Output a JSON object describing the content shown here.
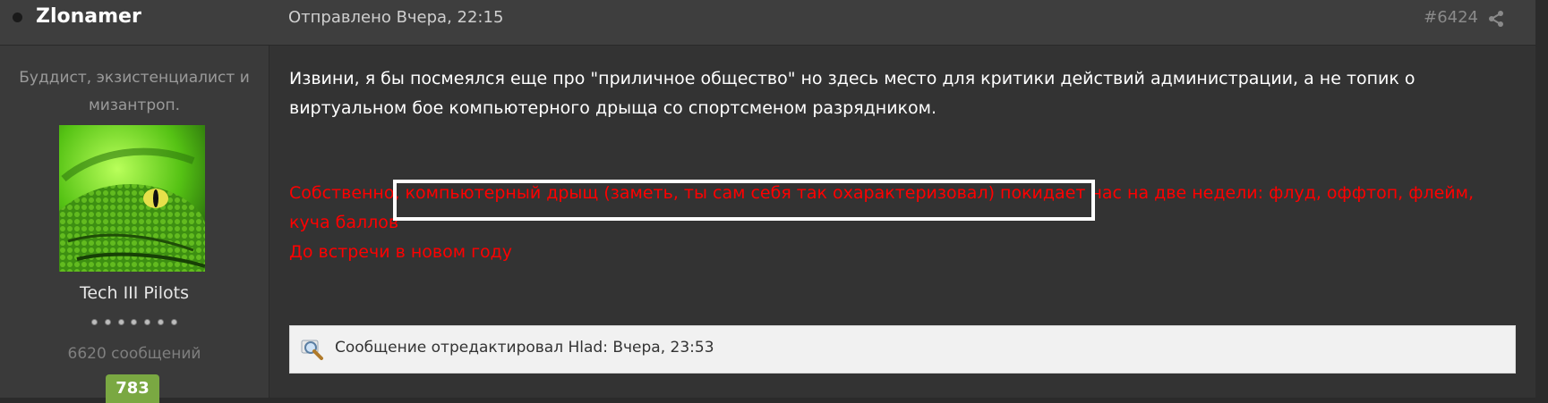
{
  "post": {
    "author": "Zlonamer",
    "posted": "Отправлено Вчера, 22:15",
    "number": "#6424",
    "body_text": "Извини, я бы посмеялся еще про \"приличное общество\" но здесь место для критики действий администрации, а не топик о виртуальном бое компьютерного дрыща со спортсменом разрядником.",
    "mod_note_line1": "Собственно, компьютерный дрыщ (заметь, ты сам себя так охарактеризовал) покидает нас на две недели: флуд, оффтоп, флейм, куча баллов",
    "mod_note_line2": "До встречи в новом году",
    "edit_note": "Сообщение отредактировал Hlad: Вчера, 23:53"
  },
  "user": {
    "title": "Буддист, экзистенциалист и мизантроп.",
    "group": "Tech III Pilots",
    "post_count": "6620 сообщений",
    "reputation": "783",
    "rank_pips": 7
  },
  "colors": {
    "background": "#333333",
    "header": "#3e3e3e",
    "sidebar": "#3a3a3a",
    "moderator_text": "#ff0000",
    "reputation_badge": "#7aa842"
  },
  "icons": {
    "share": "share-icon",
    "edit": "edit-magnifier-icon",
    "status": "offline-dot-icon"
  }
}
